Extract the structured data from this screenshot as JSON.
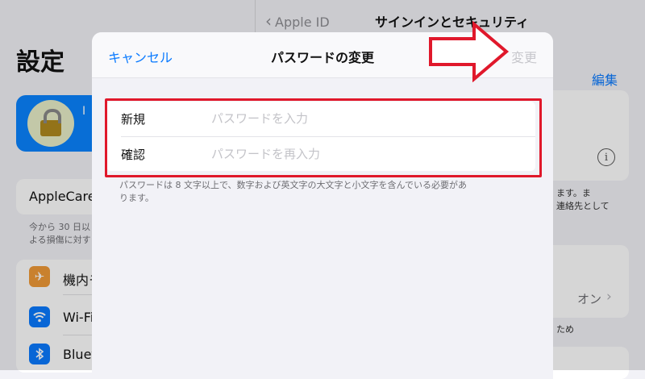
{
  "left_pane": {
    "title": "設定",
    "profile_initial": "I",
    "applecare_label": "AppleCare",
    "applecare_note": [
      "今から 30 日以",
      "よる損傷に対す"
    ],
    "items": [
      {
        "label": "機内モ",
        "icon": "airplane-icon",
        "color": "#f09a37"
      },
      {
        "label": "Wi-Fi",
        "icon": "wifi-icon",
        "color": "#0a7aff"
      },
      {
        "label": "Bluet",
        "icon": "bluetooth-icon",
        "color": "#0a7aff"
      }
    ]
  },
  "right_pane": {
    "back_label": "Apple ID",
    "title": "サインインとセキュリティ",
    "edit_label": "編集",
    "note_lines": [
      "ます。ま",
      "連絡先として"
    ],
    "on_label": "オン",
    "note2": "ため"
  },
  "modal": {
    "cancel_label": "キャンセル",
    "title": "パスワードの変更",
    "change_label": "変更",
    "fields": [
      {
        "label": "新規",
        "placeholder": "パスワードを入力"
      },
      {
        "label": "確認",
        "placeholder": "パスワードを再入力"
      }
    ],
    "hint": "パスワードは 8 文字以上で、数字および英文字の大文字と小文字を含んでいる必要があります。"
  },
  "colors": {
    "accent": "#0a7aff",
    "highlight": "#e0182b"
  }
}
